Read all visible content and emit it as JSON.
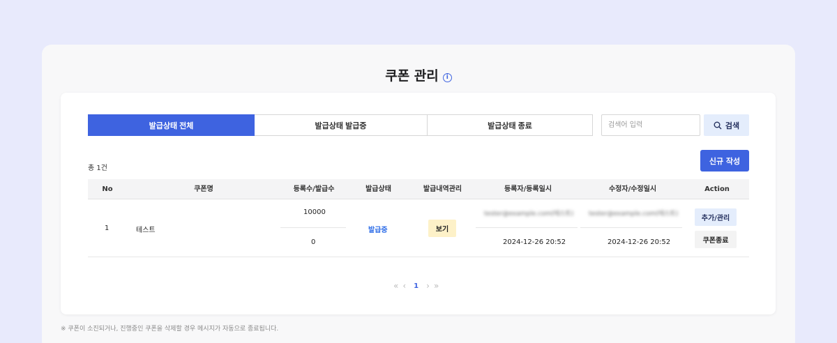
{
  "page": {
    "title": "쿠폰 관리",
    "info_icon": "info-icon"
  },
  "tabs": [
    {
      "label": "발급상태 전체",
      "active": true
    },
    {
      "label": "발급상태 발급중",
      "active": false
    },
    {
      "label": "발급상태 종료",
      "active": false
    }
  ],
  "search": {
    "placeholder": "검색어 입력",
    "button_label": "검색",
    "icon": "search-icon"
  },
  "list": {
    "count_text": "총 1건",
    "new_button_label": "신규 작성"
  },
  "table": {
    "headers": [
      "No",
      "쿠폰명",
      "등록수/발급수",
      "발급상태",
      "발급내역관리",
      "등록자/등록일시",
      "수정자/수정일시",
      "Action"
    ],
    "rows": [
      {
        "no": "1",
        "name": "테스트",
        "registered": "10000",
        "issued": "0",
        "status": "발급중",
        "history_button": "보기",
        "register_user": "tester@example.com(테스트)",
        "register_time": "2024-12-26 20:52",
        "modify_user": "tester@example.com(테스트)",
        "modify_time": "2024-12-26 20:52",
        "add_button": "추가/관리",
        "end_button": "쿠폰종료"
      }
    ]
  },
  "pagination": {
    "first": "«",
    "prev": "‹",
    "current": "1",
    "next": "›",
    "last": "»"
  },
  "footer": {
    "note": "※ 쿠폰이 소진되거나, 진행중인 쿠폰을 삭제할 경우 메시지가 자동으로 종료됩니다."
  },
  "colors": {
    "primary": "#3e63e0",
    "status": "#2f6ee8",
    "view_bg": "#fdf1c8",
    "light_button": "#e4edfc"
  }
}
